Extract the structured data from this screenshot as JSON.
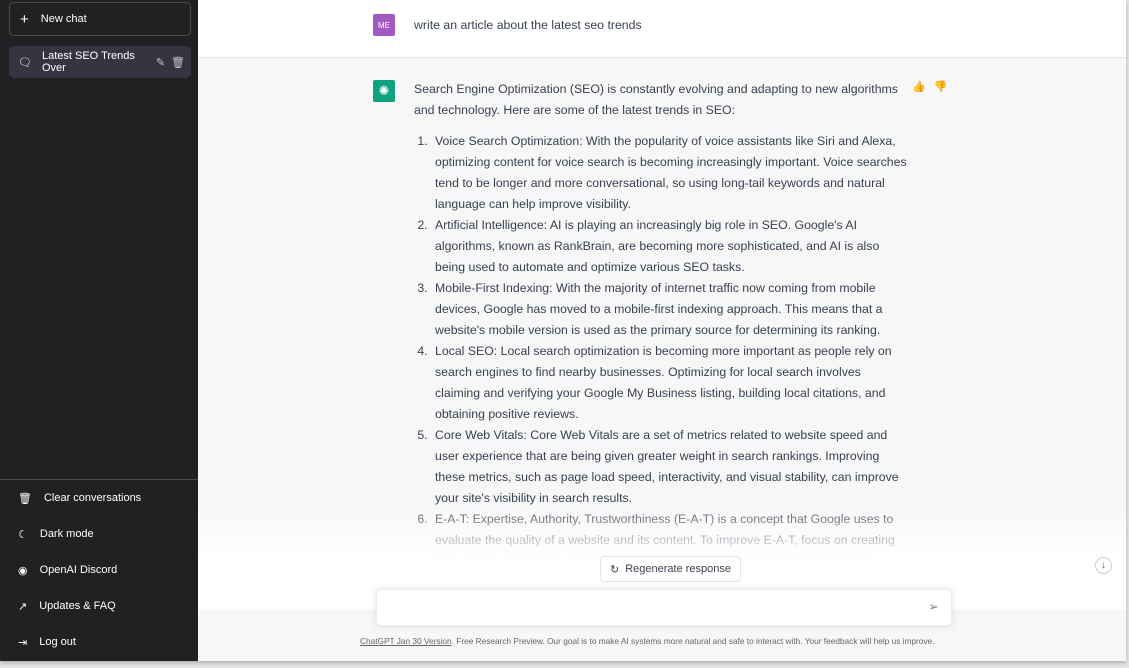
{
  "sidebar": {
    "new_chat": "New chat",
    "conversation": "Latest SEO Trends Over",
    "bottom": [
      {
        "label": "Clear conversations",
        "icon": "trash-icon"
      },
      {
        "label": "Dark mode",
        "icon": "moon-icon"
      },
      {
        "label": "OpenAI Discord",
        "icon": "discord-icon"
      },
      {
        "label": "Updates & FAQ",
        "icon": "external-link-icon"
      },
      {
        "label": "Log out",
        "icon": "logout-icon"
      }
    ]
  },
  "colors": {
    "sidebar": "#202123",
    "user_avatar": "#a259c4",
    "assistant_avatar": "#10a37f"
  },
  "user": {
    "avatar": "ME",
    "message": "write an article about the latest seo trends"
  },
  "assistant": {
    "intro": "Search Engine Optimization (SEO) is constantly evolving and adapting to new algorithms and technology. Here are some of the latest trends in SEO:",
    "items": [
      "Voice Search Optimization: With the popularity of voice assistants like Siri and Alexa, optimizing content for voice search is becoming increasingly important. Voice searches tend to be longer and more conversational, so using long-tail keywords and natural language can help improve visibility.",
      "Artificial Intelligence: AI is playing an increasingly big role in SEO. Google's AI algorithms, known as RankBrain, are becoming more sophisticated, and AI is also being used to automate and optimize various SEO tasks.",
      "Mobile-First Indexing: With the majority of internet traffic now coming from mobile devices, Google has moved to a mobile-first indexing approach. This means that a website's mobile version is used as the primary source for determining its ranking.",
      "Local SEO: Local search optimization is becoming more important as people rely on search engines to find nearby businesses. Optimizing for local search involves claiming and verifying your Google My Business listing, building local citations, and obtaining positive reviews.",
      "Core Web Vitals: Core Web Vitals are a set of metrics related to website speed and user experience that are being given greater weight in search rankings. Improving these metrics, such as page load speed, interactivity, and visual stability, can improve your site's visibility in search results.",
      "E-A-T: Expertise, Authority, Trustworthiness (E-A-T) is a concept that Google uses to evaluate the quality of a website and its content. To improve E-A-T, focus on creating high-quality, informative content, and building a strong online reputation through backlinks, social media presence, and positive reviews."
    ]
  },
  "regenerate": "Regenerate response",
  "input": {
    "placeholder": ""
  },
  "footer": {
    "link": "ChatGPT Jan 30 Version",
    "text": ". Free Research Preview. Our goal is to make AI systems more natural and safe to interact with. Your feedback will help us improve."
  }
}
